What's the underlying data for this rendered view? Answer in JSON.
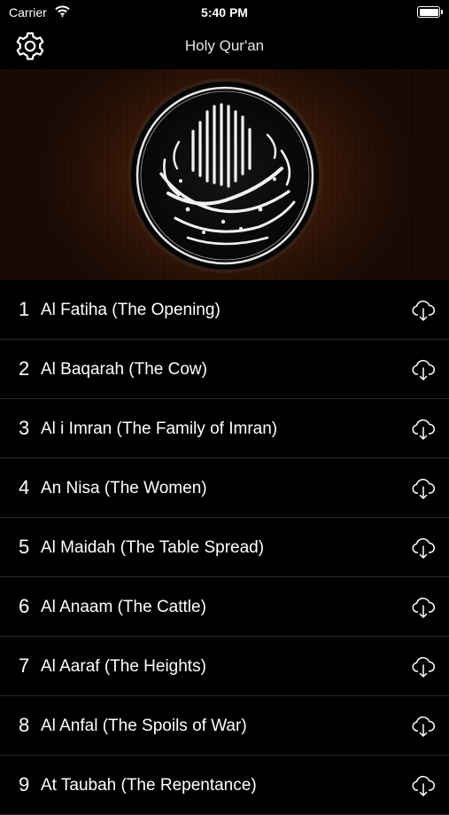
{
  "status_bar": {
    "carrier": "Carrier",
    "time": "5:40 PM"
  },
  "navbar": {
    "title": "Holy Qur'an"
  },
  "icons": {
    "settings": "gear-icon",
    "download": "cloud-download-icon",
    "wifi": "wifi-icon",
    "battery": "battery-icon"
  },
  "colors": {
    "background": "#000000",
    "banner": "#3f1a08",
    "text": "#ffffff"
  },
  "surahs": [
    {
      "number": "1",
      "title": "Al Fatiha (The Opening)"
    },
    {
      "number": "2",
      "title": "Al Baqarah (The Cow)"
    },
    {
      "number": "3",
      "title": "Al i Imran (The Family of Imran)"
    },
    {
      "number": "4",
      "title": "An Nisa (The Women)"
    },
    {
      "number": "5",
      "title": "Al Maidah (The Table Spread)"
    },
    {
      "number": "6",
      "title": "Al Anaam (The Cattle)"
    },
    {
      "number": "7",
      "title": "Al Aaraf (The Heights)"
    },
    {
      "number": "8",
      "title": "Al Anfal (The Spoils of War)"
    },
    {
      "number": "9",
      "title": "At Taubah (The Repentance)"
    }
  ]
}
